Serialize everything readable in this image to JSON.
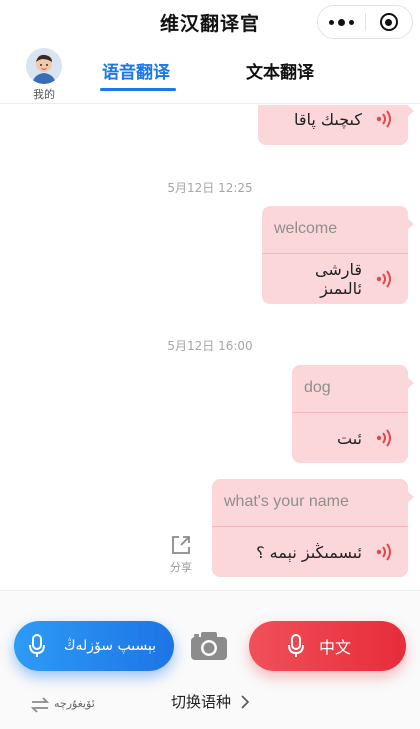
{
  "header": {
    "title": "维汉翻译官"
  },
  "tabs": {
    "me_label": "我的",
    "voice": "语音翻译",
    "text": "文本翻译"
  },
  "messages": [
    {
      "target": "كىچىك پاقا"
    },
    {
      "time": "5月12日 12:25",
      "source": "welcome",
      "target": "قارشى ئالىمىز"
    },
    {
      "time": "5月12日 16:00",
      "source": "dog",
      "target": "ئىت"
    },
    {
      "source": "what's your name",
      "target": "ئىسمىڭىز نېمە ؟"
    }
  ],
  "share_label": "分享",
  "bottom": {
    "uyghur_button": "بېسىپ سۆزلەڭ",
    "chinese_button": "中文",
    "switch_uyghur": "ئۆيغۇرچە",
    "switch_lang": "切换语种"
  },
  "colors": {
    "accent_blue": "#1a78e8",
    "accent_red": "#e82c3a",
    "bubble_pink": "#fcd7d9"
  }
}
